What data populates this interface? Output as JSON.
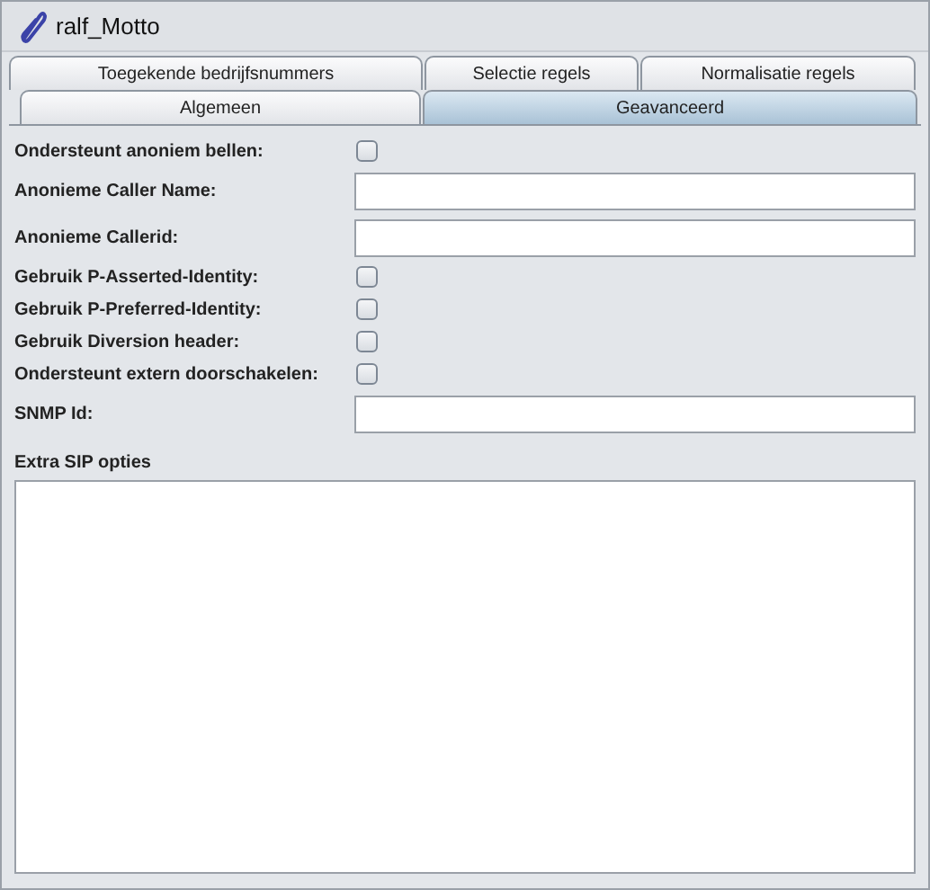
{
  "window": {
    "title": "ralf_Motto"
  },
  "tab_rows": [
    [
      {
        "label": "Toegekende bedrijfsnummers",
        "selected": false
      },
      {
        "label": "Selectie regels",
        "selected": false
      },
      {
        "label": "Normalisatie regels",
        "selected": false
      }
    ],
    [
      {
        "label": "Algemeen",
        "selected": false
      },
      {
        "label": "Geavanceerd",
        "selected": true
      }
    ]
  ],
  "fields": [
    {
      "kind": "checkbox",
      "label": "Ondersteunt anoniem bellen:",
      "checked": false
    },
    {
      "kind": "text",
      "label": "Anonieme Caller Name:"
    },
    {
      "kind": "text",
      "label": "Anonieme Callerid:"
    },
    {
      "kind": "checkbox",
      "label": "Gebruik P-Asserted-Identity:",
      "checked": false
    },
    {
      "kind": "checkbox",
      "label": "Gebruik P-Preferred-Identity:",
      "checked": false
    },
    {
      "kind": "checkbox",
      "label": "Gebruik Diversion header:",
      "checked": false
    },
    {
      "kind": "checkbox",
      "label": "Ondersteunt extern doorschakelen:",
      "checked": false
    },
    {
      "kind": "text",
      "label": "SNMP Id:"
    }
  ],
  "extra": {
    "label": "Extra SIP opties"
  }
}
